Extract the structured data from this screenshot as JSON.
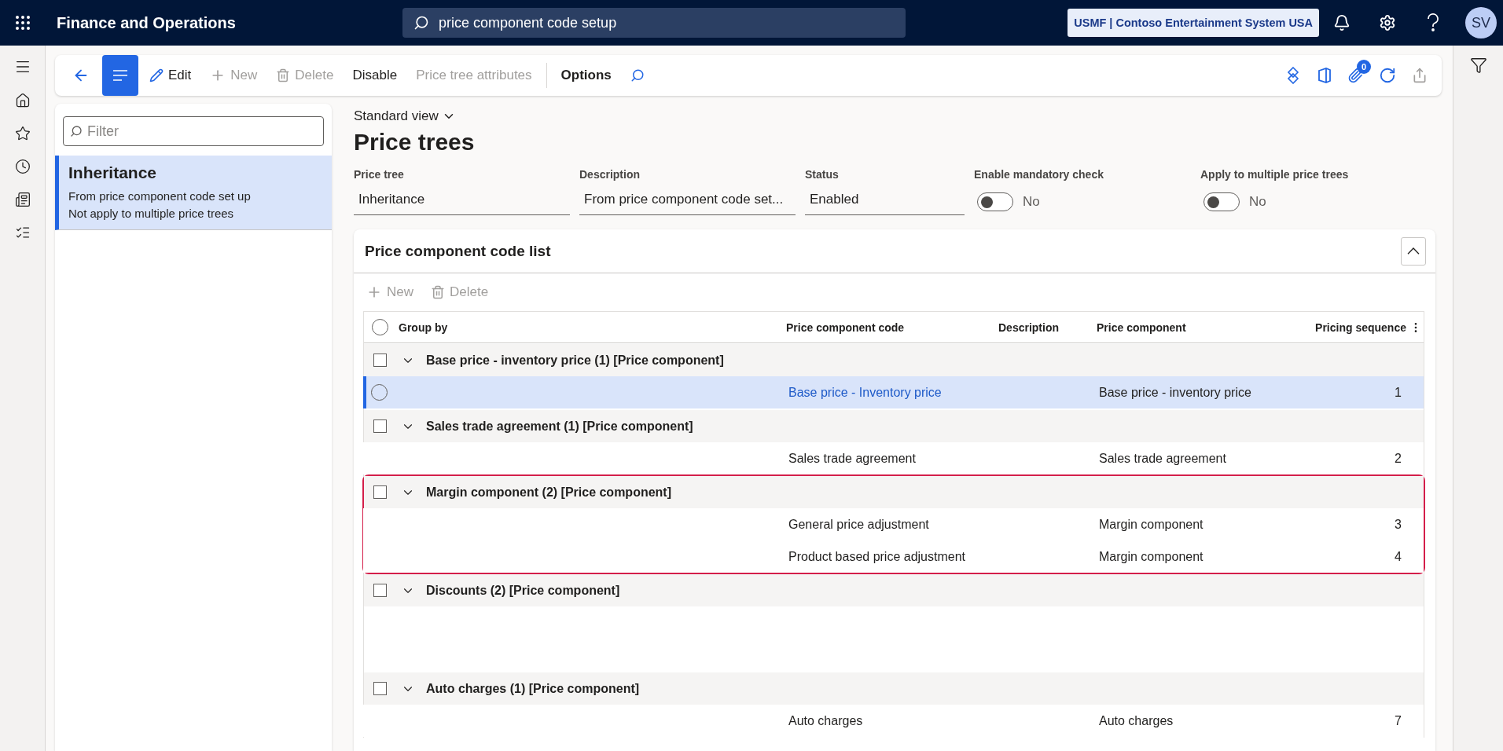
{
  "header": {
    "app_title": "Finance and Operations",
    "search": "price component code setup",
    "company": "USMF | Contoso Entertainment System USA",
    "user_initials": "SV"
  },
  "toolbar": {
    "actions": [
      {
        "kind": "edit",
        "label": "Edit",
        "disabled": false
      },
      {
        "kind": "add",
        "label": "New",
        "disabled": true
      },
      {
        "kind": "delete",
        "label": "Delete",
        "disabled": true
      },
      {
        "kind": "text",
        "label": "Disable",
        "disabled": false
      },
      {
        "kind": "text",
        "label": "Price tree attributes",
        "disabled": true
      }
    ],
    "options": "Options",
    "attachment_count": "0"
  },
  "list_panel": {
    "filter_placeholder": "Filter",
    "items": [
      {
        "title": "Inheritance",
        "lines": [
          "From price component code set up",
          "Not apply to multiple price trees"
        ],
        "selected": true
      }
    ]
  },
  "view": "Standard view",
  "page_title": "Price trees",
  "fields": [
    {
      "kind": "text",
      "label": "Price tree",
      "value": "Inheritance"
    },
    {
      "kind": "text",
      "label": "Description",
      "value": "From price component code set..."
    },
    {
      "kind": "text",
      "label": "Status",
      "value": "Enabled"
    },
    {
      "kind": "toggle",
      "label": "Enable mandatory check",
      "on": false,
      "value": "No"
    },
    {
      "kind": "toggle",
      "label": "Apply to multiple price trees",
      "on": false,
      "value": "No"
    }
  ],
  "section": {
    "title": "Price component code list",
    "expanded": true,
    "actions": [
      {
        "kind": "add",
        "label": "New",
        "disabled": true
      },
      {
        "kind": "delete",
        "label": "Delete",
        "disabled": true
      }
    ],
    "all_selected": false,
    "columns": [
      "Group by",
      "Price component code",
      "Description",
      "Price component",
      "Pricing sequence"
    ],
    "groups": [
      {
        "title": "Base price - inventory price (1) [Price component]",
        "checked": false,
        "expanded": true,
        "highlighted": false,
        "rows": [
          {
            "code": "Base price - Inventory price",
            "component": "Base price - inventory price",
            "sequence": "1",
            "selected": true
          }
        ]
      },
      {
        "title": "Sales trade agreement (1) [Price component]",
        "checked": false,
        "expanded": true,
        "highlighted": false,
        "rows": [
          {
            "code": "Sales trade agreement",
            "component": "Sales trade agreement",
            "sequence": "2",
            "selected": false
          }
        ]
      },
      {
        "title": "Margin component (2) [Price component]",
        "checked": false,
        "expanded": true,
        "highlighted": true,
        "rows": [
          {
            "code": "General price adjustment",
            "component": "Margin component",
            "sequence": "3",
            "selected": false
          },
          {
            "code": "Product based price adjustment",
            "component": "Margin component",
            "sequence": "4",
            "selected": false
          }
        ]
      },
      {
        "title": "Discounts (2) [Price component]",
        "checked": false,
        "expanded": true,
        "highlighted": false
      },
      {
        "title": "Auto charges (1) [Price component]",
        "checked": false,
        "expanded": true,
        "highlighted": false,
        "rows": [
          {
            "code": "Auto charges",
            "component": "Auto charges",
            "sequence": "7",
            "selected": false
          }
        ]
      }
    ]
  }
}
